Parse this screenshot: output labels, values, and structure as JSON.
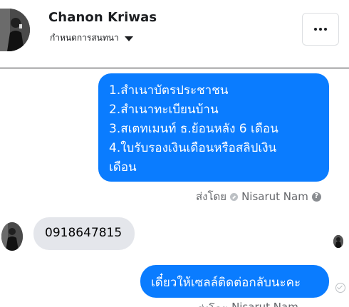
{
  "header": {
    "contact_name": "Chanon Kriwas",
    "subtitle": "กำหนดการสนทนา",
    "more_button_icon": "more-horizontal-icon",
    "caret_icon": "caret-down-icon"
  },
  "messages": {
    "outgoing_list": {
      "lines": [
        "1.สำเนาบัตรประชาชน",
        "2.สำเนาทะเบียนบ้าน",
        "3.สเตทเมนท์ ธ.ย้อนหลัง 6 เดือน",
        "4.ใบรับรองเงินเดือนหรือสลิปเงิน",
        "เดือน"
      ],
      "sent_by_label": "ส่งโดย",
      "sent_by_name": "Nisarut Nam",
      "help_glyph": "?"
    },
    "incoming_phone": {
      "text": "0918647815"
    },
    "outgoing_reply": {
      "text": "เดี๋ยวให้เซลล์ติดต่อกลับนะคะ",
      "sent_by_label": "ส่งโดย",
      "sent_by_name": "Nisarut Nam"
    }
  },
  "colors": {
    "outgoing_bubble": "#0a7cff",
    "incoming_bubble": "#e4e6eb",
    "meta_text": "#65676b"
  }
}
